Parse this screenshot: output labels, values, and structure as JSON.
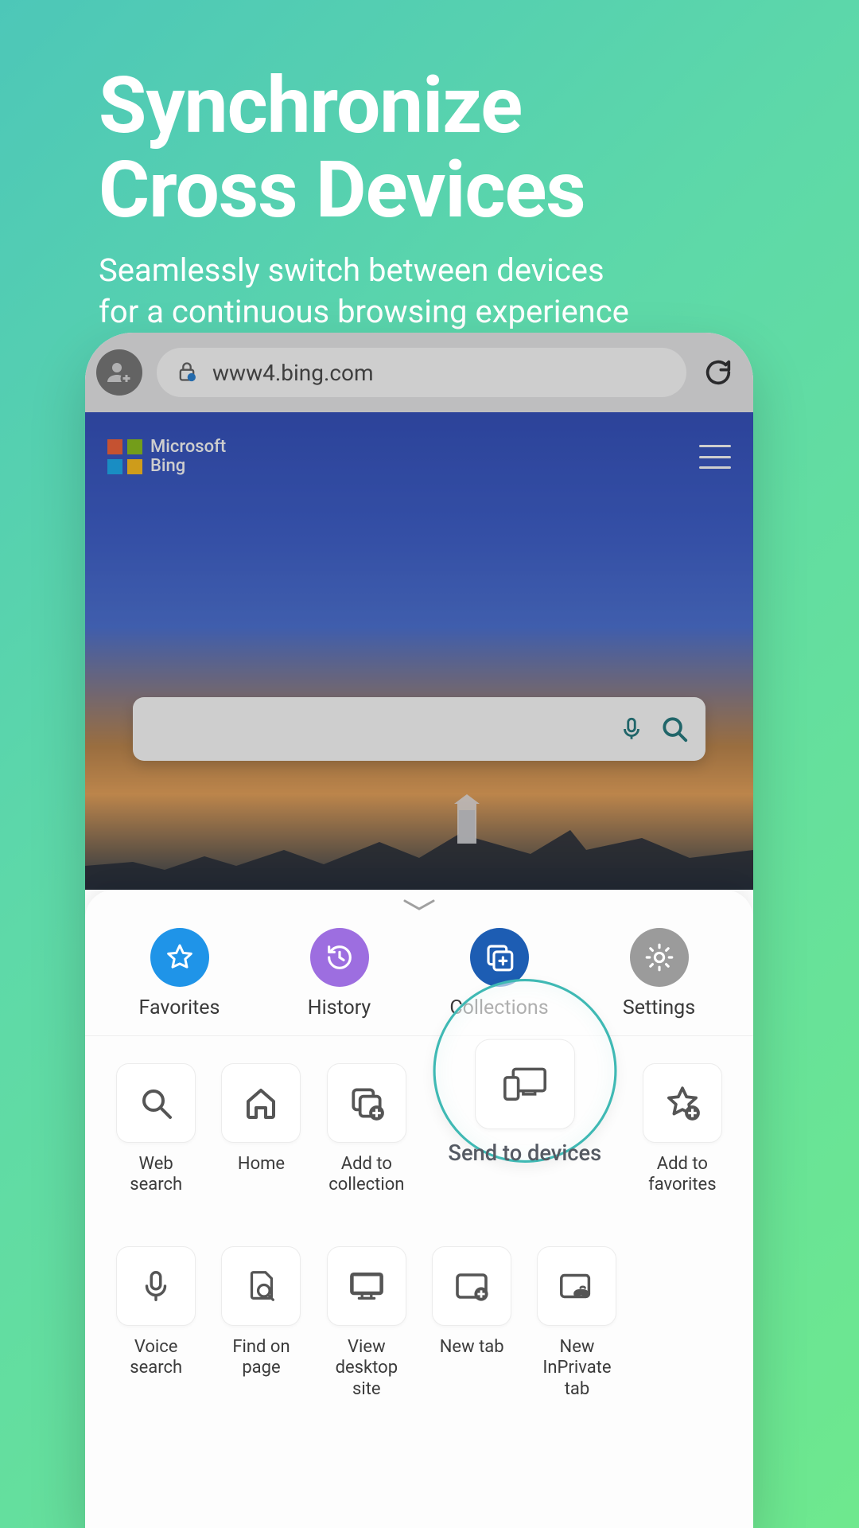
{
  "hero": {
    "title_line1": "Synchronize",
    "title_line2": "Cross Devices",
    "subtitle_line1": "Seamlessly switch between devices",
    "subtitle_line2": "for a continuous browsing experience"
  },
  "browser": {
    "url": "www4.bing.com",
    "brand_line1": "Microsoft",
    "brand_line2": "Bing"
  },
  "sheet": {
    "top": [
      {
        "label": "Favorites",
        "icon": "star",
        "bg": "#1f94e8"
      },
      {
        "label": "History",
        "icon": "history",
        "bg": "#9d6ee0"
      },
      {
        "label": "Collections",
        "icon": "collect",
        "bg": "#1d5db3"
      },
      {
        "label": "Settings",
        "icon": "gear",
        "bg": "#9b9b9b"
      }
    ],
    "grid": [
      {
        "label": "Web search",
        "icon": "search"
      },
      {
        "label": "Home",
        "icon": "home"
      },
      {
        "label": "Add to collection",
        "icon": "collect-add"
      },
      {
        "label": "Send to devices",
        "icon": "devices",
        "highlight": true
      },
      {
        "label": "Add to favorites",
        "icon": "star-add"
      },
      {
        "label": "Voice search",
        "icon": "mic"
      },
      {
        "label": "Find on page",
        "icon": "find"
      },
      {
        "label": "View desktop site",
        "icon": "desktop"
      },
      {
        "label": "New tab",
        "icon": "tab-new"
      },
      {
        "label": "New InPrivate tab",
        "icon": "tab-private"
      }
    ]
  }
}
